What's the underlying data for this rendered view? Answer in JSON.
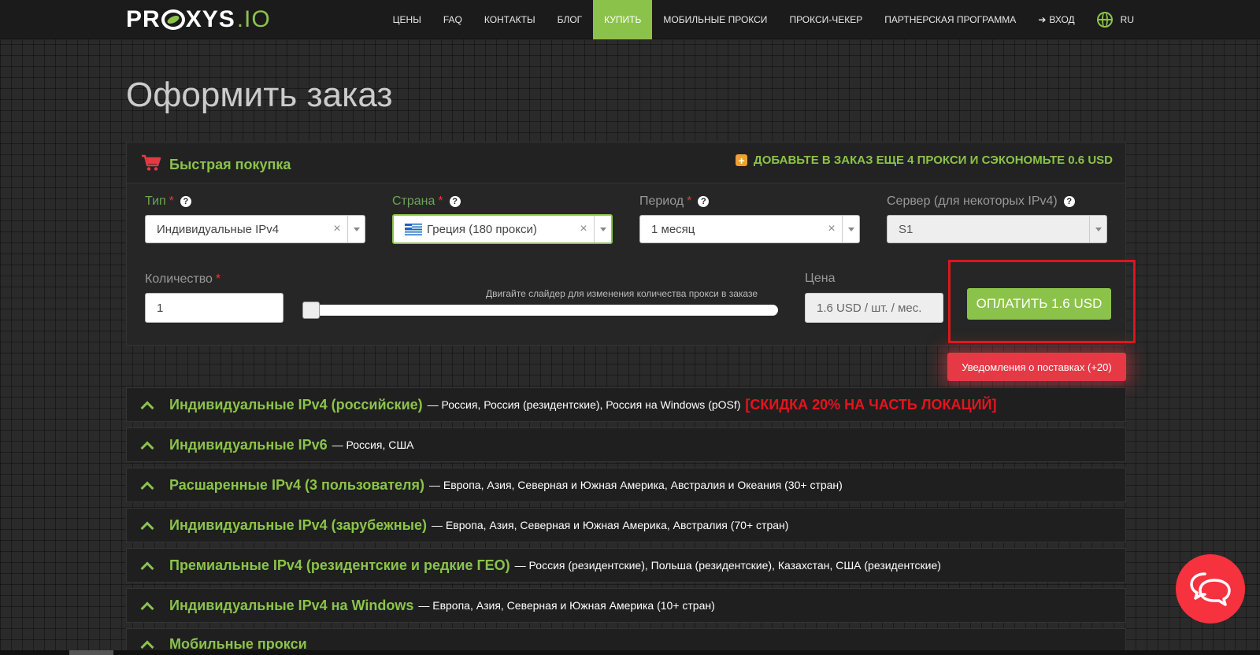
{
  "header": {
    "logo": {
      "part1": "PR",
      "part2": "XYS",
      "part3": ".IO"
    },
    "nav": [
      {
        "label": "ЦЕНЫ"
      },
      {
        "label": "FAQ"
      },
      {
        "label": "КОНТАКТЫ"
      },
      {
        "label": "БЛОГ"
      },
      {
        "label": "КУПИТЬ",
        "active": true
      },
      {
        "label": "МОБИЛЬНЫЕ ПРОКСИ"
      },
      {
        "label": "ПРОКСИ-ЧЕКЕР"
      },
      {
        "label": "ПАРТНЕРСКАЯ ПРОГРАММА"
      }
    ],
    "login_label": "ВХОД",
    "lang_label": "RU"
  },
  "page": {
    "title": "Оформить заказ"
  },
  "order": {
    "title": "Быстрая покупка",
    "promo": "ДОБАВЬТЕ В ЗАКАЗ ЕЩЕ 4 ПРОКСИ И СЭКОНОМЬТЕ 0.6 USD",
    "type": {
      "label": "Тип",
      "value": "Индивидуальные IPv4"
    },
    "country": {
      "label": "Страна",
      "value": "Греция (180 прокси)"
    },
    "period": {
      "label": "Период",
      "value": "1 месяц"
    },
    "server": {
      "label": "Сервер (для некоторых IPv4)",
      "value": "S1"
    },
    "quantity": {
      "label": "Количество",
      "value": "1"
    },
    "slider_hint": "Двигайте слайдер для изменения количества прокси в заказе",
    "slider_value": 1,
    "price": {
      "label": "Цена",
      "value": "1.6 USD / шт. / мес."
    },
    "pay_label": "ОПЛАТИТЬ 1.6 USD",
    "notify_label": "Уведомления о поставках (+20)"
  },
  "categories": [
    {
      "title": "Индивидуальные IPv4 (российские)",
      "desc": "— Россия, Россия (резидентские), Россия на Windows (pOSf)",
      "promo": "[Скидка 20% на часть локаций]"
    },
    {
      "title": "Индивидуальные IPv6",
      "desc": "— Россия, США",
      "promo": ""
    },
    {
      "title": "Расшаренные IPv4 (3 пользователя)",
      "desc": "— Европа, Азия, Северная и Южная Америка, Австралия и Океания (30+ стран)",
      "promo": ""
    },
    {
      "title": "Индивидуальные IPv4 (зарубежные)",
      "desc": "— Европа, Азия, Северная и Южная Америка, Австралия (70+ стран)",
      "promo": ""
    },
    {
      "title": "Премиальные IPv4 (резидентские и редкие ГЕО)",
      "desc": "— Россия (резидентские), Польша (резидентские), Казахстан, США (резидентские)",
      "promo": ""
    },
    {
      "title": "Индивидуальные IPv4 на Windows",
      "desc": "— Европа, Азия, Северная и Южная Америка (10+ стран)",
      "promo": ""
    },
    {
      "title": "Мобильные прокси",
      "desc": "",
      "promo": ""
    }
  ],
  "colors": {
    "accent": "#8bc34a",
    "danger": "#e53945",
    "promo_red": "#e5141e"
  }
}
